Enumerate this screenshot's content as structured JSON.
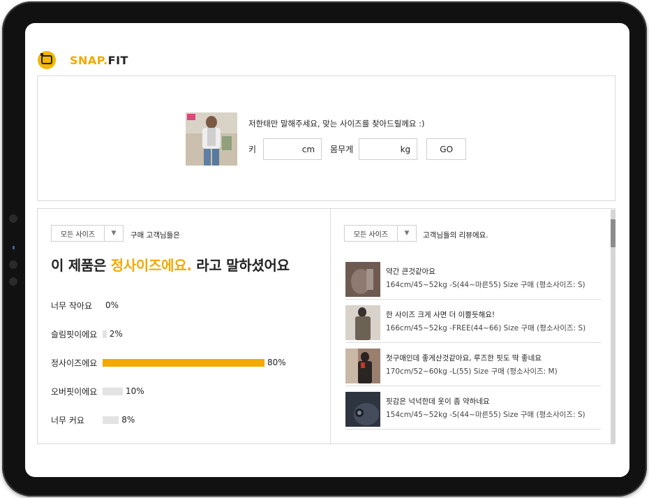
{
  "brand": {
    "snap": "SNAP.",
    "fit": "FIT"
  },
  "size_form": {
    "prompt": "저한태만 말해주세요, 맞는 사이즈를 찾아드릴께요 :)",
    "height_label": "키",
    "height_unit": "cm",
    "weight_label": "몸무게",
    "weight_unit": "kg",
    "go_label": "GO"
  },
  "survey": {
    "filter_value": "모든 사이즈",
    "caption": "구매 고객님들은",
    "headline_prefix": "이 제품은 ",
    "headline_highlight": "정사이즈에요.",
    "headline_suffix": " 라고 말하셨어요",
    "bars": [
      {
        "label": "너무 작아요",
        "value": 0,
        "pct_text": "0%"
      },
      {
        "label": "슬림핏이에요",
        "value": 2,
        "pct_text": "2%"
      },
      {
        "label": "정사이즈에요",
        "value": 80,
        "pct_text": "80%"
      },
      {
        "label": "오버핏이에요",
        "value": 10,
        "pct_text": "10%"
      },
      {
        "label": "너무 커요",
        "value": 8,
        "pct_text": "8%"
      }
    ],
    "colors": {
      "highlight": "#f2a900",
      "bar_muted": "#e3e3e3"
    }
  },
  "reviews": {
    "filter_value": "모든 사이즈",
    "caption": "고객님들의 리뷰에요.",
    "items": [
      {
        "title": "약간 큰것같아요",
        "meta": "164cm/45~52kg -S(44~마른55) Size 구매 (평소사이즈: S)"
      },
      {
        "title": "한 사이즈 크게 사면 더 이쁠듯해요!",
        "meta": "166cm/45~52kg -FREE(44~66) Size 구매 (평소사이즈: S)"
      },
      {
        "title": "첫구매인데 좋게산것같아요, 루즈한 핏도 딱 좋네요",
        "meta": "170cm/52~60kg -L(55) Size 구매 (평소사이즈: M)"
      },
      {
        "title": "핏감은 넉넉한데 옷이 좀 약하네요",
        "meta": "154cm/45~52kg -S(44~마른55) Size 구매 (평소사이즈: S)"
      }
    ]
  }
}
